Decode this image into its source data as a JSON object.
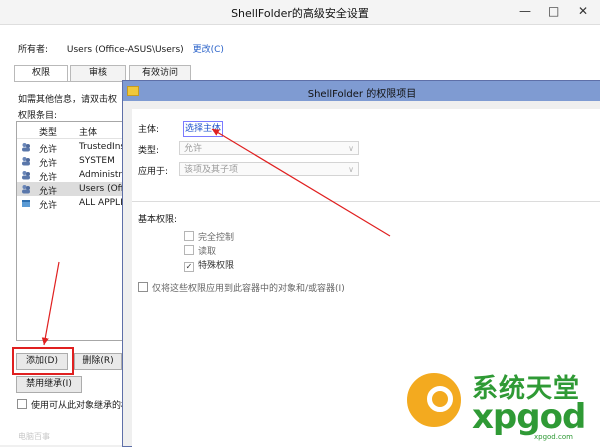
{
  "back_window": {
    "title": "ShellFolder的高级安全设置",
    "owner_label": "所有者:",
    "owner_value": "Users (Office-ASUS\\Users)",
    "owner_change": "更改(C)",
    "tabs": [
      "权限",
      "审核",
      "有效访问"
    ],
    "info_text": "如需其他信息，请双击权",
    "entries_label": "权限条目:",
    "columns": [
      "类型",
      "主体"
    ],
    "entries": [
      {
        "type": "允许",
        "principal": "TrustedInst"
      },
      {
        "type": "允许",
        "principal": "SYSTEM"
      },
      {
        "type": "允许",
        "principal": "Administrat"
      },
      {
        "type": "允许",
        "principal": "Users (Offic"
      },
      {
        "type": "允许",
        "principal": "ALL APPLIC"
      }
    ],
    "add_button": "添加(D)",
    "delete_button": "删除(R)",
    "disable_inherit_button": "禁用继承(I)",
    "inherit_checkbox": "使用可从此对象继承的权",
    "corner_text": "电脑百事"
  },
  "dialog": {
    "title": "ShellFolder 的权限项目",
    "principal_label": "主体:",
    "principal_link": "选择主体",
    "type_label": "类型:",
    "type_value": "允许",
    "apply_label": "应用于:",
    "apply_value": "该项及其子项",
    "basic_perm_label": "基本权限:",
    "permissions": [
      {
        "label": "完全控制",
        "checked": false
      },
      {
        "label": "读取",
        "checked": false
      },
      {
        "label": "特殊权限",
        "checked": true
      }
    ],
    "apply_only": "仅将这些权限应用到此容器中的对象和/或容器(I)"
  },
  "watermark": {
    "cn": "系统天堂",
    "en": "xpgod",
    "url": "xpgod.com"
  },
  "colors": {
    "annotation_red": "#e02020",
    "dialog_titlebar": "#7f9bd2",
    "link_blue": "#2255cc",
    "watermark_orange": "#f3aa1f",
    "watermark_green": "#2f9a35"
  }
}
